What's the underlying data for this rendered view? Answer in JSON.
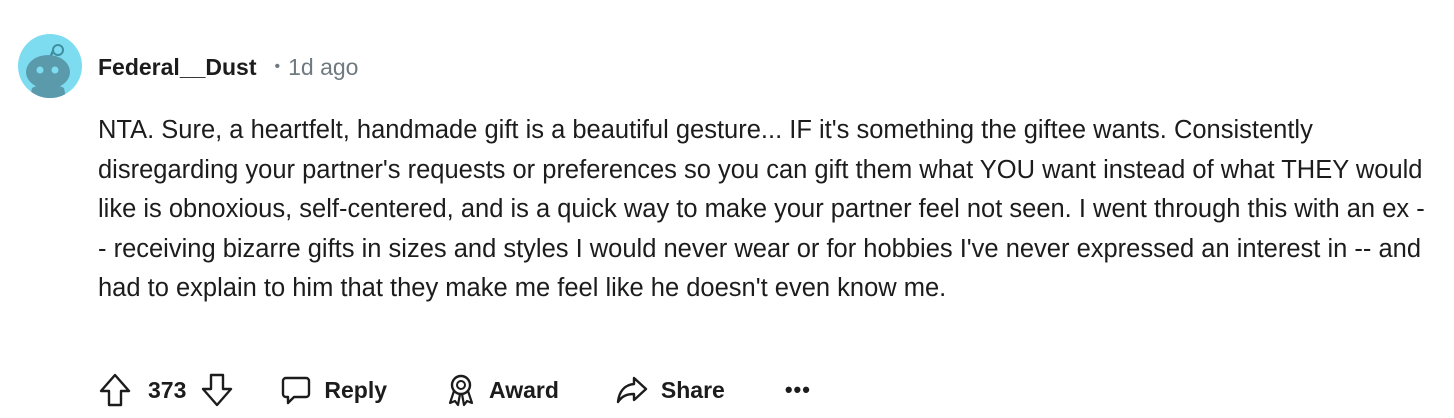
{
  "comment": {
    "author": "Federal__Dust",
    "separator": "•",
    "time": "1d ago",
    "body": "NTA. Sure, a heartfelt, handmade gift is a beautiful gesture... IF it's something the giftee wants. Consistently disregarding your partner's requests or preferences so you can gift them what YOU want instead of what THEY would like is obnoxious, self-centered, and is a quick way to make your partner feel not seen. I went through this with an ex -- receiving bizarre gifts in sizes and styles I would never wear or for hobbies I've never expressed an interest in -- and had to explain to him that they make me feel like he doesn't even know me.",
    "score": "373"
  },
  "actions": {
    "reply": "Reply",
    "award": "Award",
    "share": "Share",
    "more": "•••"
  },
  "icons": {
    "avatar": "snoo-avatar",
    "upvote": "upvote-arrow-icon",
    "downvote": "downvote-arrow-icon",
    "reply": "speech-bubble-icon",
    "award": "award-ribbon-icon",
    "share": "share-arrow-icon",
    "more": "more-options-icon"
  },
  "colors": {
    "avatar_bg": "#7ddcf0",
    "text": "#1c1c1c",
    "muted": "#6e7a80"
  }
}
